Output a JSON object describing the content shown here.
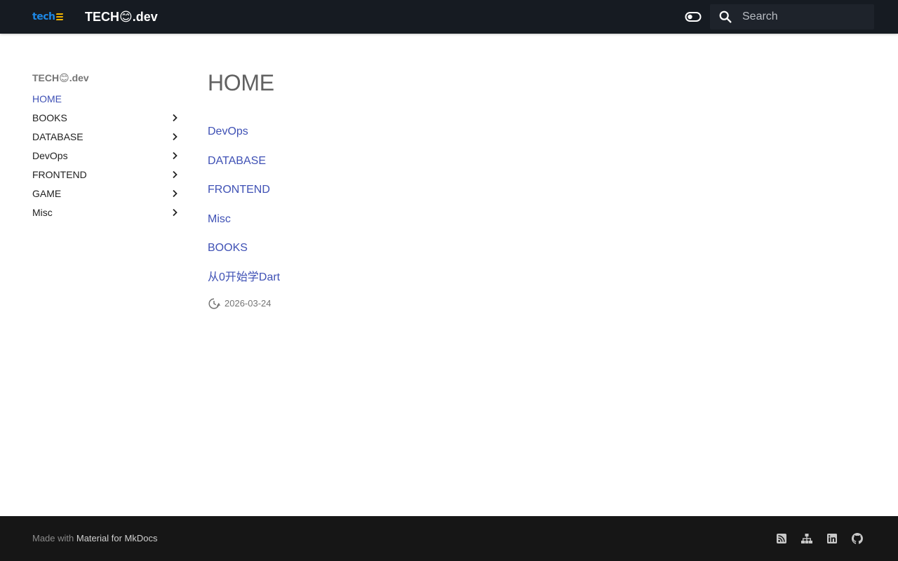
{
  "header": {
    "logo_text": "tech",
    "site_title": "TECH😊.dev",
    "search_placeholder": "Search"
  },
  "sidebar": {
    "title": "TECH😊.dev",
    "items": [
      {
        "label": "HOME",
        "active": true
      },
      {
        "label": "BOOKS"
      },
      {
        "label": "DATABASE"
      },
      {
        "label": "DevOps"
      },
      {
        "label": "FRONTEND"
      },
      {
        "label": "GAME"
      },
      {
        "label": "Misc"
      }
    ]
  },
  "main": {
    "title": "HOME",
    "links": [
      "DevOps",
      "DATABASE",
      "FRONTEND",
      "Misc",
      "BOOKS",
      "从0开始学Dart"
    ],
    "date": "2026-03-24"
  },
  "footer": {
    "made_with": "Made with",
    "material_link": "Material for MkDocs",
    "icons": [
      "rss-icon",
      "sitemap-icon",
      "linkedin-icon",
      "github-icon"
    ]
  },
  "colors": {
    "header_bg": "#161b22",
    "accent": "#3f51b5",
    "footer_bg": "#161616",
    "logo_blue": "#1e88e5",
    "logo_yellow": "#f2b400"
  }
}
